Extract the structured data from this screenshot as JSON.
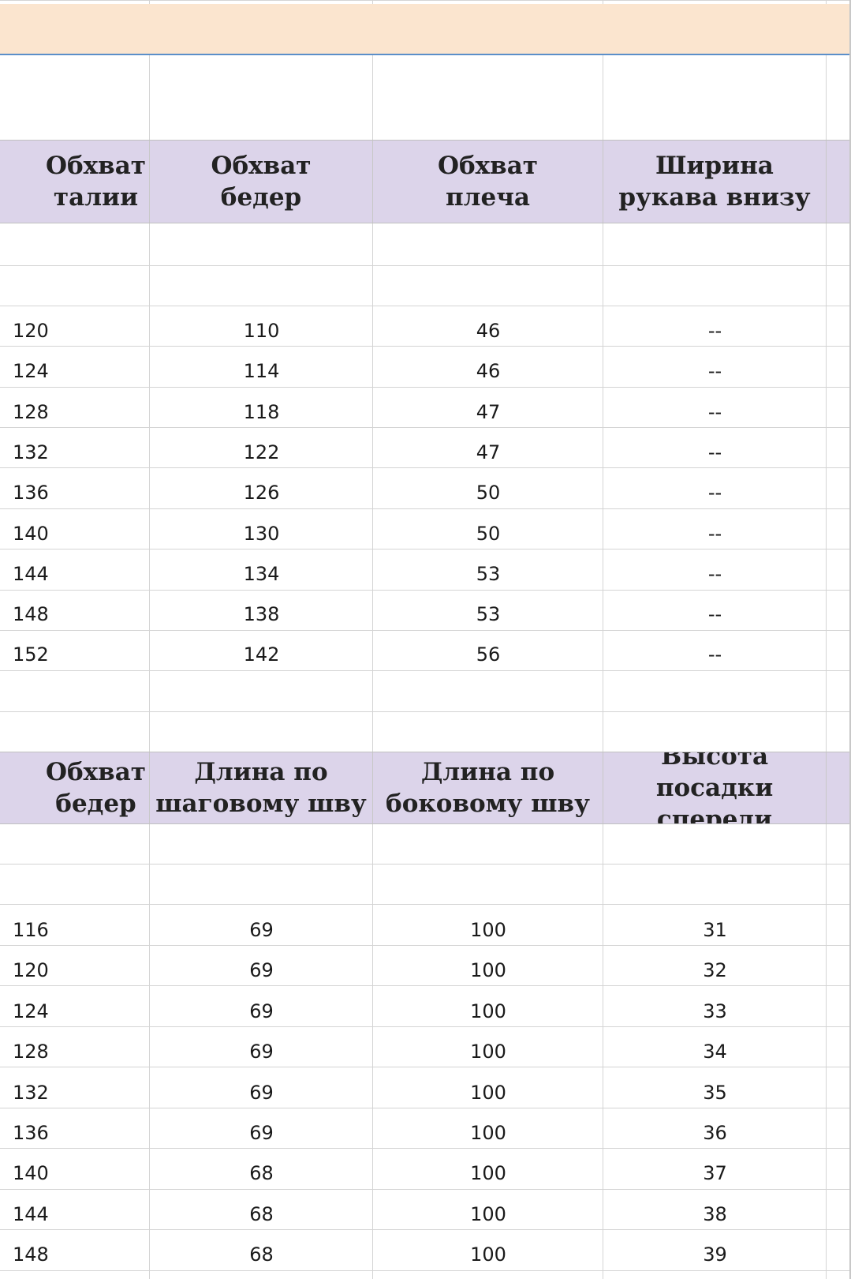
{
  "table1": {
    "headers": [
      "Обхват\nталии",
      "Обхват\nбедер",
      "Обхват\nплеча",
      "Ширина\nрукава внизу"
    ],
    "rows": [
      [
        "120",
        "110",
        "46",
        "--"
      ],
      [
        "124",
        "114",
        "46",
        "--"
      ],
      [
        "128",
        "118",
        "47",
        "--"
      ],
      [
        "132",
        "122",
        "47",
        "--"
      ],
      [
        "136",
        "126",
        "50",
        "--"
      ],
      [
        "140",
        "130",
        "50",
        "--"
      ],
      [
        "144",
        "134",
        "53",
        "--"
      ],
      [
        "148",
        "138",
        "53",
        "--"
      ],
      [
        "152",
        "142",
        "56",
        "--"
      ]
    ]
  },
  "table2": {
    "headers": [
      "Обхват\nбедер",
      "Длина по\nшаговому шву",
      "Длина по\nбоковому шву",
      "Высота посадки\nспереди"
    ],
    "rows": [
      [
        "116",
        "69",
        "100",
        "31"
      ],
      [
        "120",
        "69",
        "100",
        "32"
      ],
      [
        "124",
        "69",
        "100",
        "33"
      ],
      [
        "128",
        "69",
        "100",
        "34"
      ],
      [
        "132",
        "69",
        "100",
        "35"
      ],
      [
        "136",
        "69",
        "100",
        "36"
      ],
      [
        "140",
        "68",
        "100",
        "37"
      ],
      [
        "144",
        "68",
        "100",
        "38"
      ],
      [
        "148",
        "68",
        "100",
        "39"
      ]
    ]
  }
}
